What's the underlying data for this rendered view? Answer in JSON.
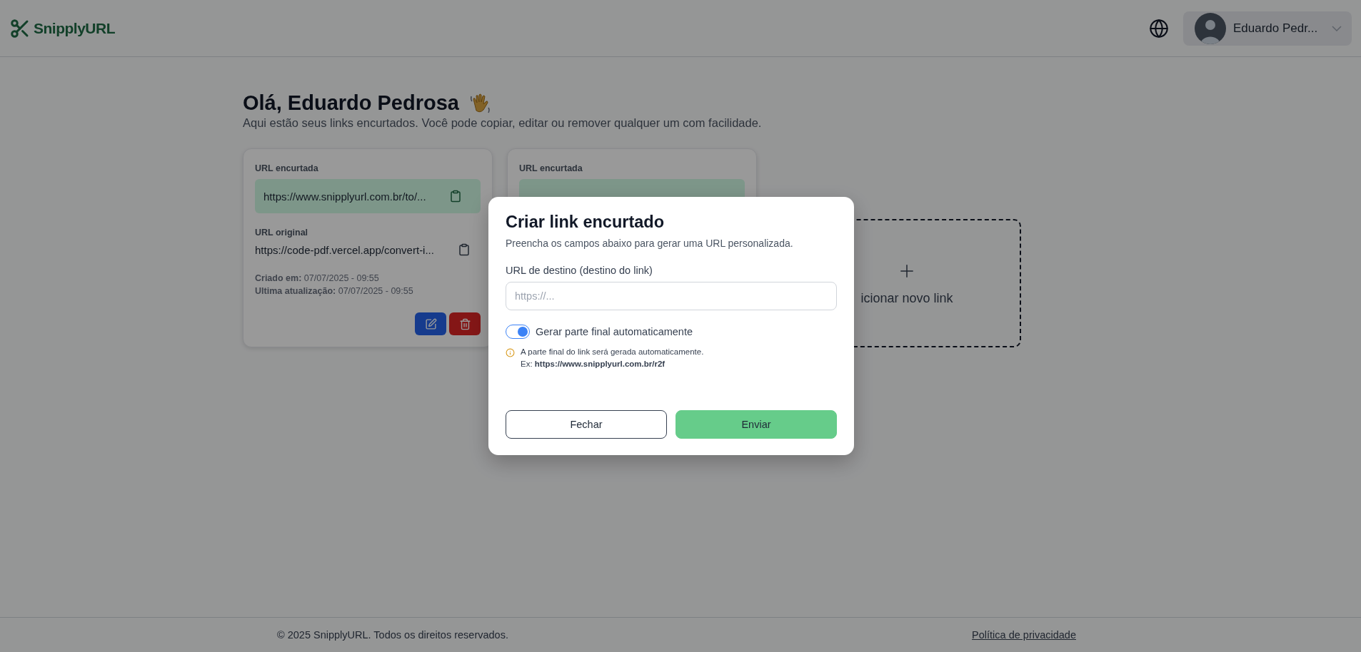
{
  "header": {
    "logo": "SnipplyURL",
    "user": {
      "name": "Eduardo Pedr..."
    }
  },
  "greeting": {
    "title": "Olá, Eduardo Pedrosa",
    "subtitle": "Aqui estão seus links encurtados. Você pode copiar, editar ou remover qualquer um com facilidade."
  },
  "links": [
    {
      "short_label": "URL encurtada",
      "short_url": "https://www.snipplyurl.com.br/to/...",
      "original_label": "URL original",
      "original_url": "https://code-pdf.vercel.app/convert-i...",
      "created_label": "Criado em:",
      "created": "07/07/2025 - 09:55",
      "updated_label": "Ultima atualização:",
      "updated": "07/07/2025 - 09:55"
    },
    {
      "short_label": "URL encurtada"
    }
  ],
  "add_card": {
    "label": "icionar novo link"
  },
  "modal": {
    "title": "Criar link encurtado",
    "description": "Preencha os campos abaixo para gerar uma URL personalizada.",
    "field_label": "URL de destino (destino do link)",
    "placeholder": "https://...",
    "toggle": {
      "label": "Gerar parte final automaticamente",
      "on": true
    },
    "hint_lines": [
      "A parte final do link será gerada automaticamente.",
      "Ex: **https://www.snipplyurl.com.br/r2f**"
    ],
    "buttons": [
      {
        "label": "Fechar",
        "kind": "secondary"
      },
      {
        "label": "Enviar",
        "kind": "primary"
      }
    ]
  },
  "footer": {
    "copyright": "© 2025 SnipplyURL. Todos os direitos reservados.",
    "link": "Política de privacidade"
  }
}
